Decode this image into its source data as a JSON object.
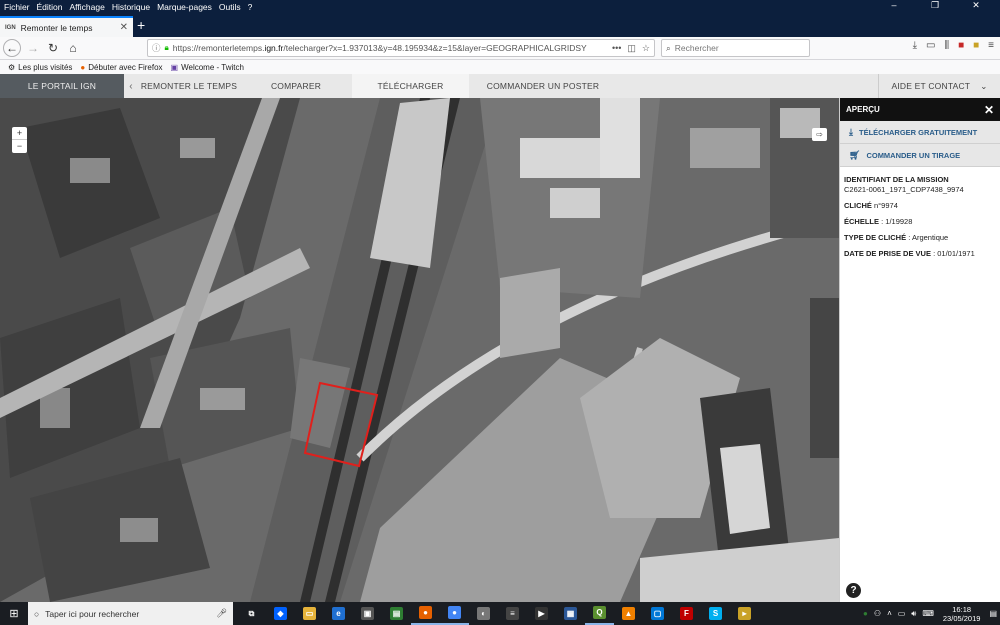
{
  "browser": {
    "menu": [
      "Fichier",
      "Édition",
      "Affichage",
      "Historique",
      "Marque-pages",
      "Outils",
      "?"
    ],
    "tab": {
      "favicon": "IGN",
      "title": "Remonter le temps"
    },
    "url_prefix": "https://remonterletemps.",
    "url_domain": "ign.fr",
    "url_suffix": "/telecharger?x=1.937013&y=48.195934&z=15&layer=GEOGRAPHICALGRIDSY",
    "search_placeholder": "Rechercher",
    "bookmarks": [
      {
        "icon": "gear-icon",
        "label": "Les plus visités"
      },
      {
        "icon": "firefox-icon",
        "label": "Débuter avec Firefox"
      },
      {
        "icon": "twitch-icon",
        "label": "Welcome - Twitch"
      }
    ]
  },
  "sitenav": {
    "portal": "LE PORTAIL IGN",
    "items": [
      "REMONTER LE TEMPS",
      "COMPARER",
      "TÉLÉCHARGER",
      "COMMANDER UN POSTER"
    ],
    "active_index": 2,
    "help": "AIDE ET CONTACT"
  },
  "map": {
    "zoom_in": "+",
    "zoom_out": "−"
  },
  "panel": {
    "title": "APERÇU",
    "download_label": "TÉLÉCHARGER GRATUITEMENT",
    "order_label": "COMMANDER UN TIRAGE",
    "mission_label": "IDENTIFIANT DE LA MISSION",
    "mission_value": "C2621-0061_1971_CDP7438_9974",
    "cliche_label": "CLICHÉ",
    "cliche_value": "n°9974",
    "echelle_label": "ÉCHELLE",
    "echelle_value": ": 1/19928",
    "type_label": "TYPE DE CLICHÉ",
    "type_value": ": Argentique",
    "date_label": "DATE DE PRISE DE VUE",
    "date_value": ": 01/01/1971",
    "help": "?"
  },
  "taskbar": {
    "search_placeholder": "Taper ici pour rechercher",
    "time": "16:18",
    "date": "23/05/2019",
    "apps": [
      {
        "name": "task-view-icon",
        "color": "#1a1d22",
        "glyph": "⧉"
      },
      {
        "name": "dropbox-icon",
        "color": "#0061fe",
        "glyph": "◆"
      },
      {
        "name": "file-explorer-icon",
        "color": "#e6b33a",
        "glyph": "▭"
      },
      {
        "name": "edge-icon",
        "color": "#1f6fd1",
        "glyph": "e"
      },
      {
        "name": "photo-app-icon",
        "color": "#555",
        "glyph": "▣"
      },
      {
        "name": "terminal-icon",
        "color": "#2e7d32",
        "glyph": "▤"
      },
      {
        "name": "firefox-icon",
        "color": "#e66000",
        "glyph": "●"
      },
      {
        "name": "chrome-icon",
        "color": "#4285f4",
        "glyph": "●"
      },
      {
        "name": "globe-app-icon",
        "color": "#777",
        "glyph": "◐"
      },
      {
        "name": "notes-app-icon",
        "color": "#444",
        "glyph": "≡"
      },
      {
        "name": "media-app-icon",
        "color": "#333",
        "glyph": "▶"
      },
      {
        "name": "id-card-icon",
        "color": "#2b5797",
        "glyph": "▦"
      },
      {
        "name": "qgis-icon",
        "color": "#5a8f2f",
        "glyph": "Q"
      },
      {
        "name": "vlc-icon",
        "color": "#f08000",
        "glyph": "▲"
      },
      {
        "name": "store-icon",
        "color": "#0078d7",
        "glyph": "▢"
      },
      {
        "name": "filezilla-icon",
        "color": "#bf0000",
        "glyph": "F"
      },
      {
        "name": "skype-icon",
        "color": "#00aff0",
        "glyph": "S"
      },
      {
        "name": "video-app-icon",
        "color": "#c9a227",
        "glyph": "▸"
      }
    ]
  }
}
